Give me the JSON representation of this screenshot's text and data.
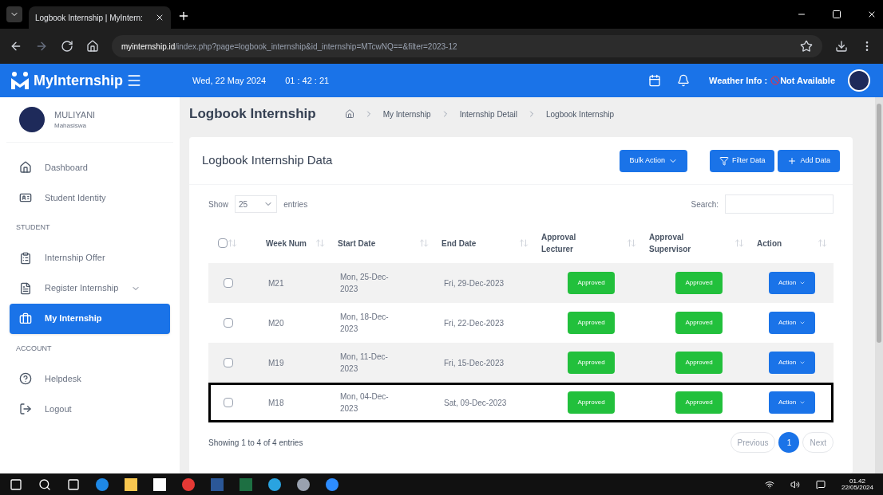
{
  "browser": {
    "tab_title": "Logbook Internship | MyIntern:",
    "url_host": "myinternship.id",
    "url_path": "/index.php?page=logbook_internship&id_internship=MTcwNQ==&filter=2023-12"
  },
  "header": {
    "brand": "MyInternship",
    "date": "Wed, 22 May 2024",
    "time": "01 : 42 : 21",
    "weather_label": "Weather Info :",
    "weather_value": "Not Available"
  },
  "user": {
    "name": "MULIYANI",
    "role": "Mahasiswa"
  },
  "sidebar": [
    {
      "kind": "item",
      "label": "Dashboard",
      "selected": false,
      "dropdown": false
    },
    {
      "kind": "item",
      "label": "Student Identity",
      "selected": false,
      "dropdown": false
    },
    {
      "kind": "section",
      "label": "STUDENT"
    },
    {
      "kind": "item",
      "label": "Internship Offer",
      "selected": false,
      "dropdown": false
    },
    {
      "kind": "item",
      "label": "Register Internship",
      "selected": false,
      "dropdown": true
    },
    {
      "kind": "item",
      "label": "My Internship",
      "selected": true,
      "dropdown": false
    },
    {
      "kind": "section",
      "label": "ACCOUNT"
    },
    {
      "kind": "item",
      "label": "Helpdesk",
      "selected": false,
      "dropdown": false
    },
    {
      "kind": "item",
      "label": "Logout",
      "selected": false,
      "dropdown": false
    }
  ],
  "page_title": "Logbook Internship",
  "breadcrumb": [
    "My Internship",
    "Internship Detail",
    "Logbook Internship"
  ],
  "card": {
    "title": "Logbook Internship Data",
    "buttons": [
      {
        "kind": "dropdown",
        "label": "Bulk Action"
      },
      {
        "kind": "filter",
        "label": "Filter Data"
      },
      {
        "kind": "add",
        "label": "Add Data"
      }
    ],
    "select_all_checked": false,
    "show_label": "Show",
    "page_size": "25",
    "entries_label": "entries",
    "search_label": "Search:",
    "columns": [
      "Week Num",
      "Start Date",
      "End Date",
      "Approval Lecturer",
      "Approval Supervisor",
      "Action"
    ],
    "rows": [
      {
        "week": "M21",
        "start": "Mon, 25-Dec-2023",
        "end": "Fri, 29-Dec-2023",
        "lecturer": "Approved",
        "supervisor": "Approved",
        "action": "Action",
        "checked": false,
        "highlighted": false
      },
      {
        "week": "M20",
        "start": "Mon, 18-Dec-2023",
        "end": "Fri, 22-Dec-2023",
        "lecturer": "Approved",
        "supervisor": "Approved",
        "action": "Action",
        "checked": false,
        "highlighted": false
      },
      {
        "week": "M19",
        "start": "Mon, 11-Dec-2023",
        "end": "Fri, 15-Dec-2023",
        "lecturer": "Approved",
        "supervisor": "Approved",
        "action": "Action",
        "checked": false,
        "highlighted": false
      },
      {
        "week": "M18",
        "start": "Mon, 04-Dec-2023",
        "end": "Sat, 09-Dec-2023",
        "lecturer": "Approved",
        "supervisor": "Approved",
        "action": "Action",
        "checked": false,
        "highlighted": true
      }
    ],
    "info": "Showing 1 to 4 of 4 entries",
    "pagination": [
      {
        "label": "Previous",
        "selected": false
      },
      {
        "label": "1",
        "selected": true
      },
      {
        "label": "Next",
        "selected": false
      }
    ]
  },
  "taskbar": {
    "time": "01.42",
    "date": "22/05/2024"
  }
}
